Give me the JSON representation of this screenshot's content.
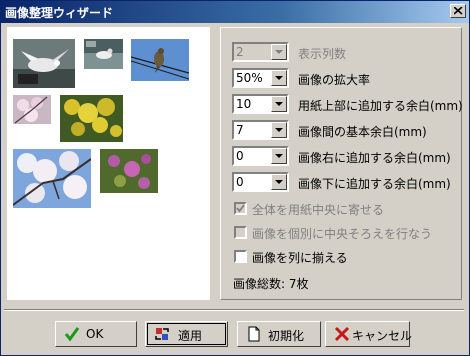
{
  "window": {
    "title": "画像整理ウィザード"
  },
  "icons": {
    "close": "close-icon",
    "ok": "checkmark-icon",
    "apply": "apply-arrows-icon",
    "reset": "blank-page-icon",
    "cancel": "x-cancel-icon"
  },
  "settings": [
    {
      "value": "2",
      "label": "表示列数",
      "disabled": true
    },
    {
      "value": "50%",
      "label": "画像の拡大率",
      "disabled": false
    },
    {
      "value": "10",
      "label": "用紙上部に追加する余白(mm)",
      "disabled": false
    },
    {
      "value": "7",
      "label": "画像間の基本余白(mm)",
      "disabled": false
    },
    {
      "value": "0",
      "label": "画像右に追加する余白(mm)",
      "disabled": false
    },
    {
      "value": "0",
      "label": "画像下に追加する余白(mm)",
      "disabled": false
    }
  ],
  "checkboxes": [
    {
      "label": "全体を用紙中央に寄せる",
      "checked": true,
      "disabled": true
    },
    {
      "label": "画像を個別に中央そろえを行なう",
      "checked": false,
      "disabled": true
    },
    {
      "label": "画像を列に揃える",
      "checked": false,
      "disabled": false
    }
  ],
  "summary": {
    "total_text": "画像総数: 7枚"
  },
  "buttons": {
    "ok": "OK",
    "apply": "適用",
    "reset": "初期化",
    "cancel": "キャンセル"
  },
  "colors": {
    "title_start": "#0a246a",
    "title_end": "#a6caf0",
    "face": "#d4d0c8"
  }
}
